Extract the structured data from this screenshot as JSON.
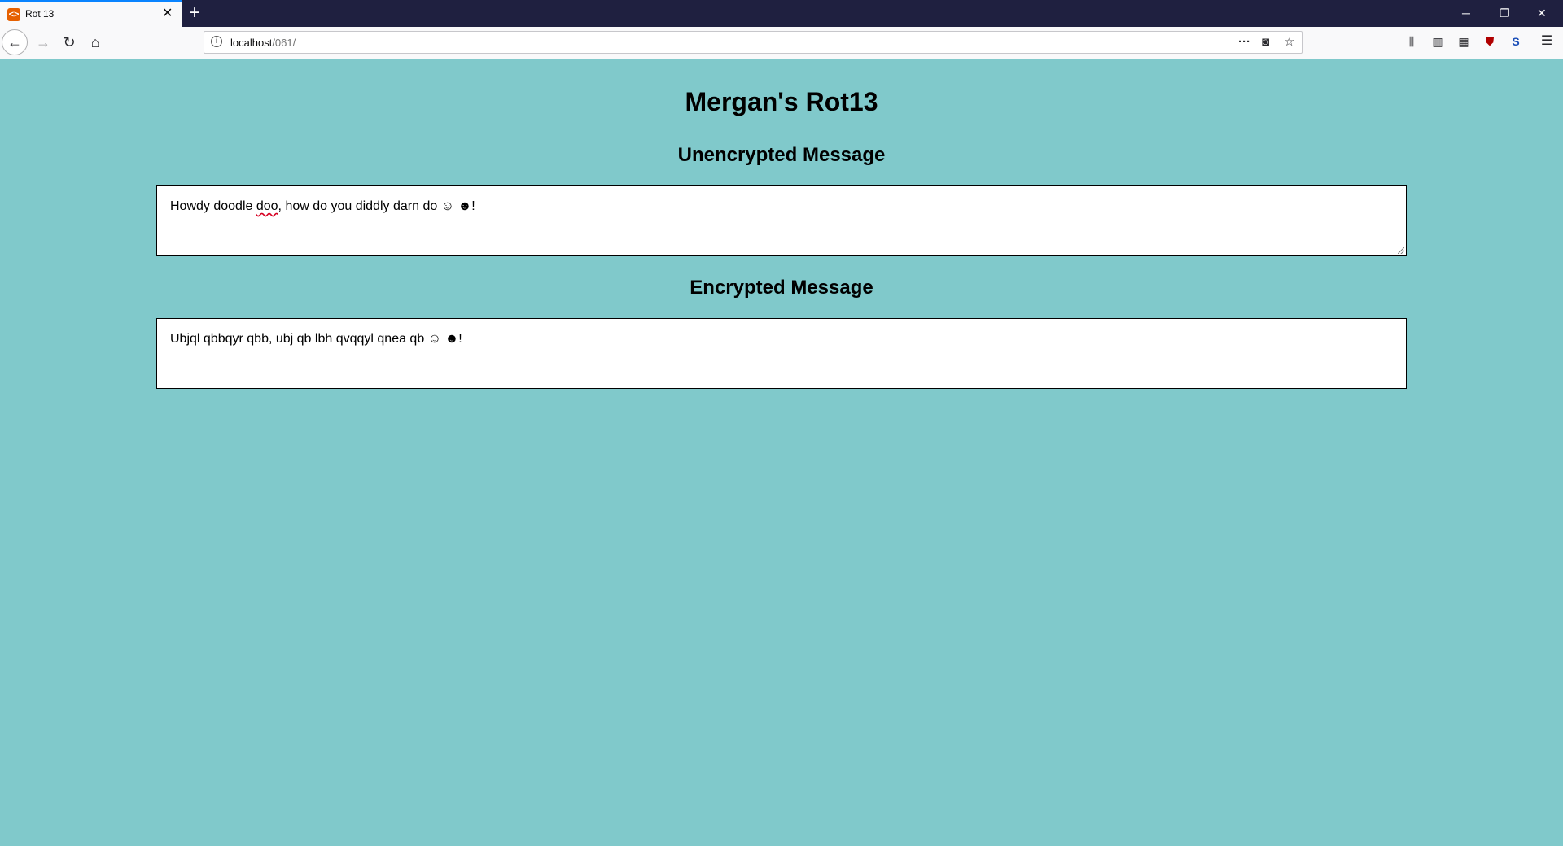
{
  "browser": {
    "tab_title": "Rot 13",
    "tab_favicon": "html-icon",
    "new_tab_label": "+",
    "url_host": "localhost",
    "url_path": "/061/",
    "window_controls": {
      "minimize": "─",
      "restore": "❐",
      "close": "✕"
    }
  },
  "page": {
    "title": "Mergan's Rot13",
    "unencrypted_heading": "Unencrypted Message",
    "unencrypted_value_pre": "Howdy doodle ",
    "unencrypted_value_flag": "doo",
    "unencrypted_value_post": ", how do you diddly darn do ☺ ☻!",
    "encrypted_heading": "Encrypted Message",
    "encrypted_value": "Ubjql qbbqyr qbb, ubj qb lbh qvqqyl qnea qb ☺ ☻!"
  },
  "colors": {
    "page_background": "#80c9cb",
    "tabbar_background": "#1f2040",
    "active_tab_accent": "#0a84ff"
  }
}
